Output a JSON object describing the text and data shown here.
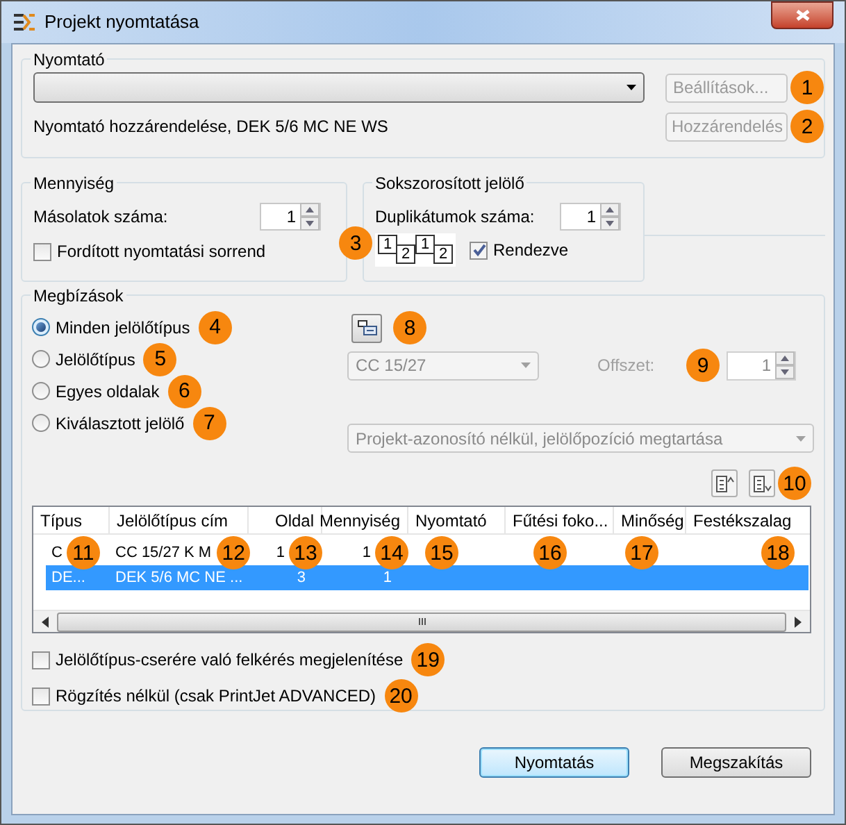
{
  "window": {
    "title": "Projekt nyomtatása"
  },
  "printer": {
    "title": "Nyomtató",
    "settings_button": {
      "label": "Beállítások...",
      "disabled": true
    },
    "assignment": "Nyomtató hozzárendelése, DEK 5/6 MC NE WS",
    "assign_button": {
      "label": "Hozzárendelés",
      "disabled": true
    }
  },
  "quantity": {
    "title": "Mennyiség",
    "copies_label": "Másolatok száma:",
    "copies": "1",
    "reverse": {
      "label": "Fordított nyomtatási sorrend",
      "checked": false
    }
  },
  "duplicate": {
    "title": "Sokszorosított jelölő",
    "count_label": "Duplikátumok száma:",
    "count": "1",
    "preview": [
      "1",
      "2",
      "1",
      "2"
    ],
    "collate": {
      "label": "Rendezve",
      "checked": true
    }
  },
  "orders": {
    "title": "Megbízások",
    "options": [
      {
        "label": "Minden jelölőtípus",
        "selected": true
      },
      {
        "label": "Jelölőtípus",
        "selected": false
      },
      {
        "label": "Egyes oldalak",
        "selected": false
      },
      {
        "label": "Kiválasztott jelölő",
        "selected": false
      }
    ],
    "marker_type": {
      "value": "CC 15/27",
      "disabled": true
    },
    "offset_label": "Offszet:",
    "offset": {
      "value": "1",
      "disabled": true
    },
    "mode": {
      "value": "Projekt-azonosító nélkül, jelölőpozíció megtartása",
      "disabled": true
    },
    "table": {
      "columns": [
        "Típus",
        "Jelölőtípus cím",
        "Oldal",
        "Mennyiség",
        "Nyomtató",
        "Fűtési foko...",
        "Minőség",
        "Festékszalag"
      ],
      "rows": [
        {
          "cells": [
            "C",
            "CC 15/27 K M",
            "1",
            "1"
          ],
          "selected": false
        },
        {
          "cells": [
            "DE...",
            "DEK 5/6 MC NE ...",
            "3",
            "1"
          ],
          "selected": true
        }
      ]
    }
  },
  "options": [
    {
      "label": "Jelölőtípus-cserére való felkérés megjelenítése",
      "checked": false
    },
    {
      "label": "Rögzítés nélkül (csak PrintJet ADVANCED)",
      "checked": false
    }
  ],
  "buttons": [
    {
      "label": "Nyomtatás",
      "default": true
    },
    {
      "label": "Megszakítás",
      "default": false
    }
  ],
  "callouts": [
    "1",
    "2",
    "3",
    "4",
    "5",
    "6",
    "7",
    "8",
    "9",
    "10",
    "11",
    "12",
    "13",
    "14",
    "15",
    "16",
    "17",
    "18",
    "19",
    "20"
  ]
}
